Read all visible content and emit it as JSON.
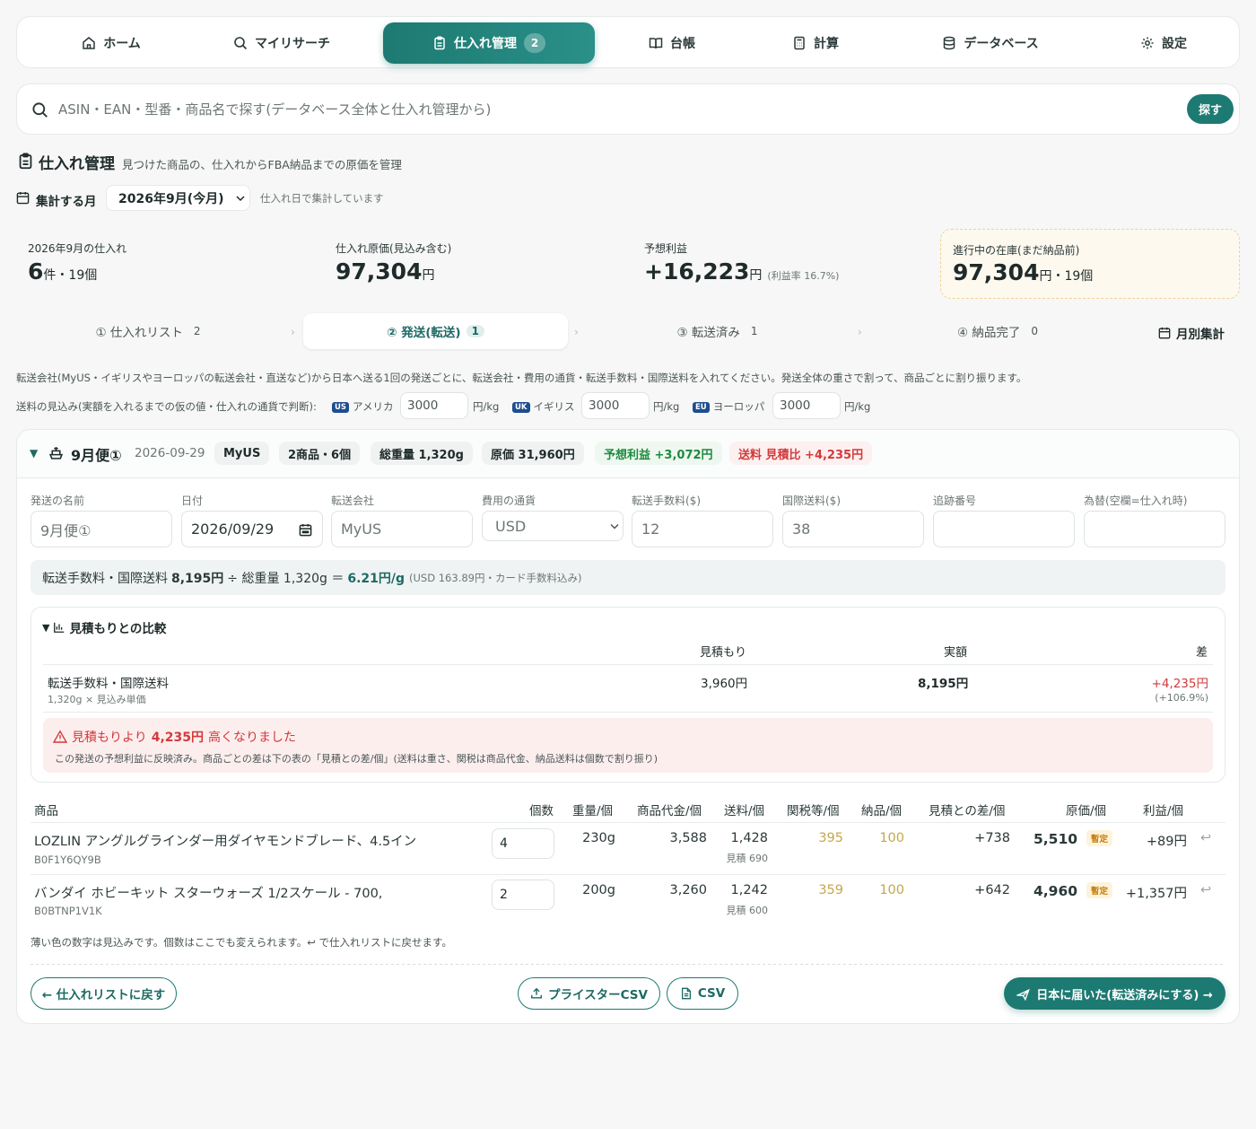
{
  "nav": {
    "items": [
      {
        "label": "ホーム",
        "icon": "home-icon"
      },
      {
        "label": "マイリサーチ",
        "icon": "search-icon"
      },
      {
        "label": "仕入れ管理",
        "icon": "clipboard-icon",
        "badge": "2",
        "active": true
      },
      {
        "label": "台帳",
        "icon": "book-icon"
      },
      {
        "label": "計算",
        "icon": "calculator-icon"
      },
      {
        "label": "データベース",
        "icon": "database-icon"
      },
      {
        "label": "設定",
        "icon": "gear-icon"
      }
    ]
  },
  "search": {
    "placeholder": "ASIN・EAN・型番・商品名で探す(データベース全体と仕入れ管理から)",
    "button": "探す"
  },
  "page": {
    "title": "仕入れ管理",
    "subtitle": "見つけた商品の、仕入れからFBA納品までの原価を管理",
    "month_label": "集計する月",
    "month_value": "2026年9月(今月)",
    "month_note": "仕入れ日で集計しています"
  },
  "stats": {
    "purchases_label": "2026年9月の仕入れ",
    "purchases_count": "6",
    "purchases_unit": "件・19個",
    "cost_label": "仕入れ原価(見込み含む)",
    "cost_value": "97,304",
    "yen": "円",
    "profit_label": "予想利益",
    "profit_value": "+16,223",
    "profit_rate": "(利益率 16.7%)",
    "stock_label": "進行中の在庫(まだ納品前)",
    "stock_value": "97,304",
    "stock_unit": "円・19個"
  },
  "steps": [
    {
      "label": "① 仕入れリスト",
      "count": "2"
    },
    {
      "label": "② 発送(転送)",
      "count": "1",
      "active": true
    },
    {
      "label": "③ 転送済み",
      "count": "1"
    },
    {
      "label": "④ 納品完了",
      "count": "0"
    }
  ],
  "monthly": "月別集計",
  "chevron": "›",
  "help_text": "転送会社(MyUS・イギリスやヨーロッパの転送会社・直送など)から日本へ送る1回の発送ごとに、転送会社・費用の通貨・転送手数料・国際送料を入れてください。発送全体の重さで割って、商品ごとに割り振ります。",
  "rates": {
    "label": "送料の見込み(実額を入れるまでの仮の値・仕入れの通貨で判断):",
    "unit": "円/kg",
    "items": [
      {
        "flag": "US",
        "name": "アメリカ",
        "value": "3000"
      },
      {
        "flag": "UK",
        "name": "イギリス",
        "value": "3000"
      },
      {
        "flag": "EU",
        "name": "ヨーロッパ",
        "value": "3000"
      }
    ]
  },
  "shipment": {
    "toggle": "▼",
    "name": "9月便①",
    "date": "2026-09-29",
    "chips": {
      "company": "MyUS",
      "items": "2商品・6個",
      "weight": "総重量 1,320g",
      "cost": "原価 31,960円",
      "profit": "予想利益 +3,072円",
      "shipping": "送料 見積比 +4,235円"
    },
    "fields": {
      "name_label": "発送の名前",
      "name_value": "9月便①",
      "date_label": "日付",
      "date_value": "2026/09/29",
      "company_label": "転送会社",
      "company_value": "MyUS",
      "currency_label": "費用の通貨",
      "currency_value": "USD",
      "fee_label": "転送手数料($)",
      "fee_value": "12",
      "intl_label": "国際送料($)",
      "intl_value": "38",
      "tracking_label": "追跡番号",
      "tracking_value": "",
      "fx_label": "為替(空欄=仕入れ時)",
      "fx_value": ""
    },
    "calc": {
      "prefix": "転送手数料・国際送料",
      "total": "8,195円",
      "div": "÷ 総重量 1,320g ＝",
      "rate": "6.21円/g",
      "note": "(USD 163.89円・カード手数料込み)"
    },
    "compare": {
      "title": "見積もりとの比較",
      "col_est": "見積もり",
      "col_actual": "実額",
      "col_diff": "差",
      "row_label": "転送手数料・国際送料",
      "row_sub": "1,320g × 見込み単価",
      "est": "3,960円",
      "actual": "8,195円",
      "diff": "+4,235円",
      "diff_pct": "(+106.9%)",
      "warn_prefix": "見積もりより",
      "warn_amount": "4,235円",
      "warn_suffix": "高くなりました",
      "warn_note": "この発送の予想利益に反映済み。商品ごとの差は下の表の「見積との差/個」(送料は重さ、関税は商品代金、納品送料は個数で割り振り)"
    },
    "table": {
      "headers": [
        "商品",
        "個数",
        "重量/個",
        "商品代金/個",
        "送料/個",
        "関税等/個",
        "納品/個",
        "見積との差/個",
        "原価/個",
        "利益/個"
      ],
      "rows": [
        {
          "name": "LOZLIN アングルグラインダー用ダイヤモンドブレード、4.5イン",
          "asin": "B0F1Y6QY9B",
          "qty": "4",
          "weight": "230g",
          "price": "3,588",
          "ship": "1,428",
          "ship_est": "見積 690",
          "duty": "395",
          "inbound": "100",
          "diff": "+738",
          "cost": "5,510",
          "tag": "暫定",
          "profit": "+89円"
        },
        {
          "name": "バンダイ ホビーキット スターウォーズ 1/2スケール - 700,",
          "asin": "B0BTNP1V1K",
          "qty": "2",
          "weight": "200g",
          "price": "3,260",
          "ship": "1,242",
          "ship_est": "見積 600",
          "duty": "359",
          "inbound": "100",
          "diff": "+642",
          "cost": "4,960",
          "tag": "暫定",
          "profit": "+1,357円"
        }
      ],
      "return_icon": "↩",
      "note": "薄い色の数字は見込みです。個数はここでも変えられます。↩ で仕入れリストに戻せます。"
    },
    "buttons": {
      "back": "← 仕入れリストに戻す",
      "pricester": "プライスターCSV",
      "csv": "CSV",
      "arrived": "日本に届いた(転送済みにする) →"
    }
  },
  "colors": {
    "accent": "#1d7a72",
    "profit": "#1e8a3e",
    "loss": "#d23a3a",
    "estimate": "#c4a74a"
  }
}
